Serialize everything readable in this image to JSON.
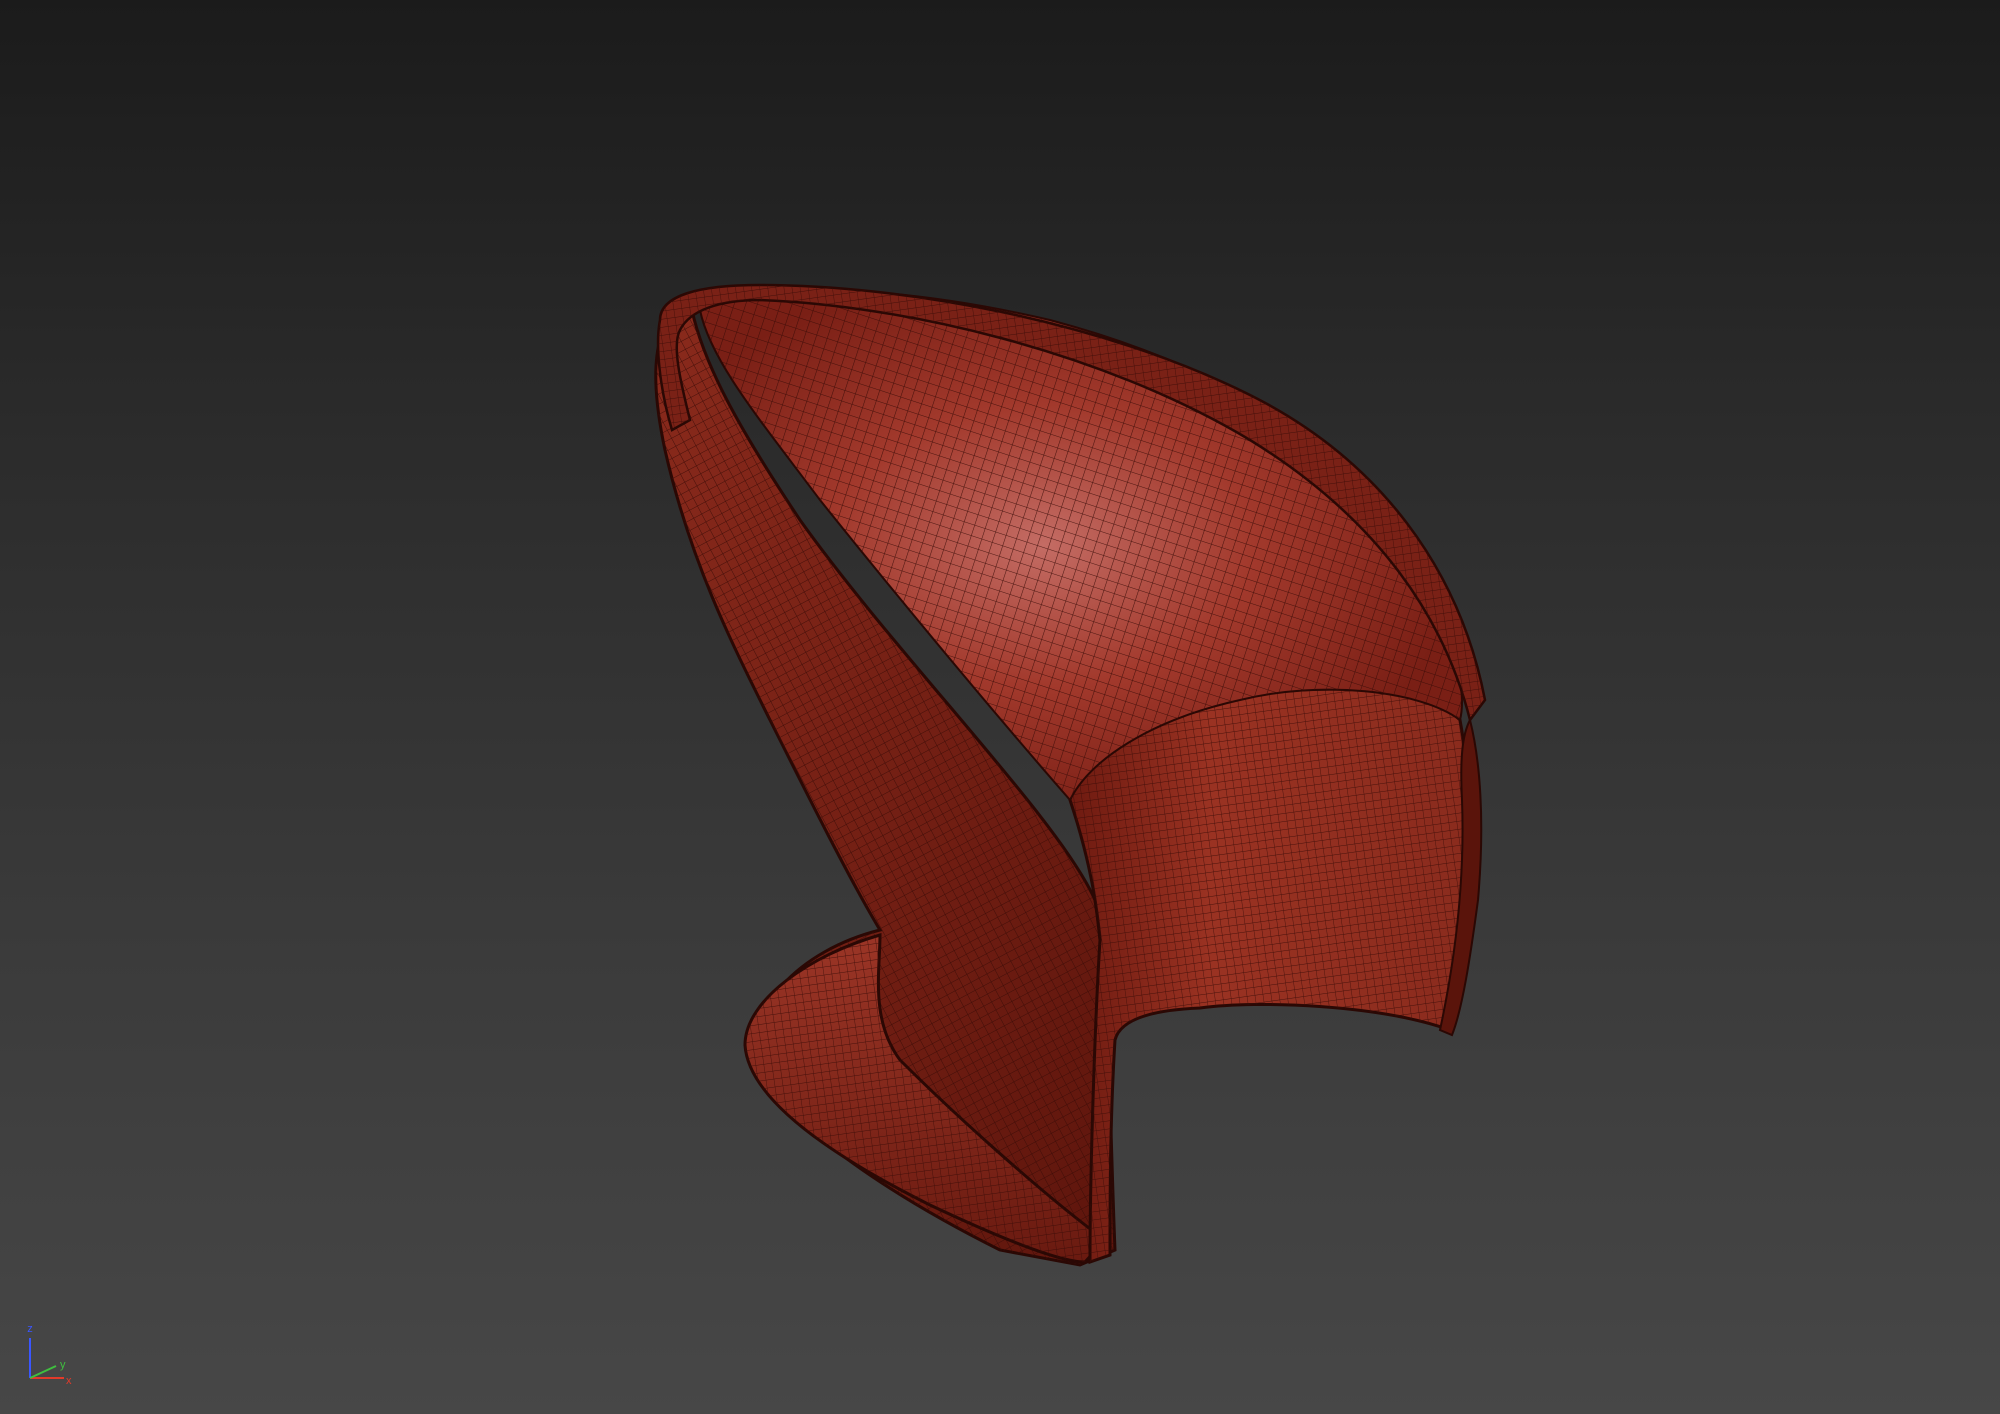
{
  "viewport": {
    "background_top": "#1b1b1b",
    "background_bottom": "#474747"
  },
  "model": {
    "object": "chair-mesh",
    "display_mode": "shaded-with-wireframe",
    "color": "#8e2a1e",
    "wire_color": "#3a0c07",
    "highlight": "#c07068"
  },
  "axis_gizmo": {
    "z_label": "z",
    "y_label": "y",
    "x_label": "x",
    "z_color": "#3a56ff",
    "y_color": "#3fbf3f",
    "x_color": "#e23a2a"
  }
}
